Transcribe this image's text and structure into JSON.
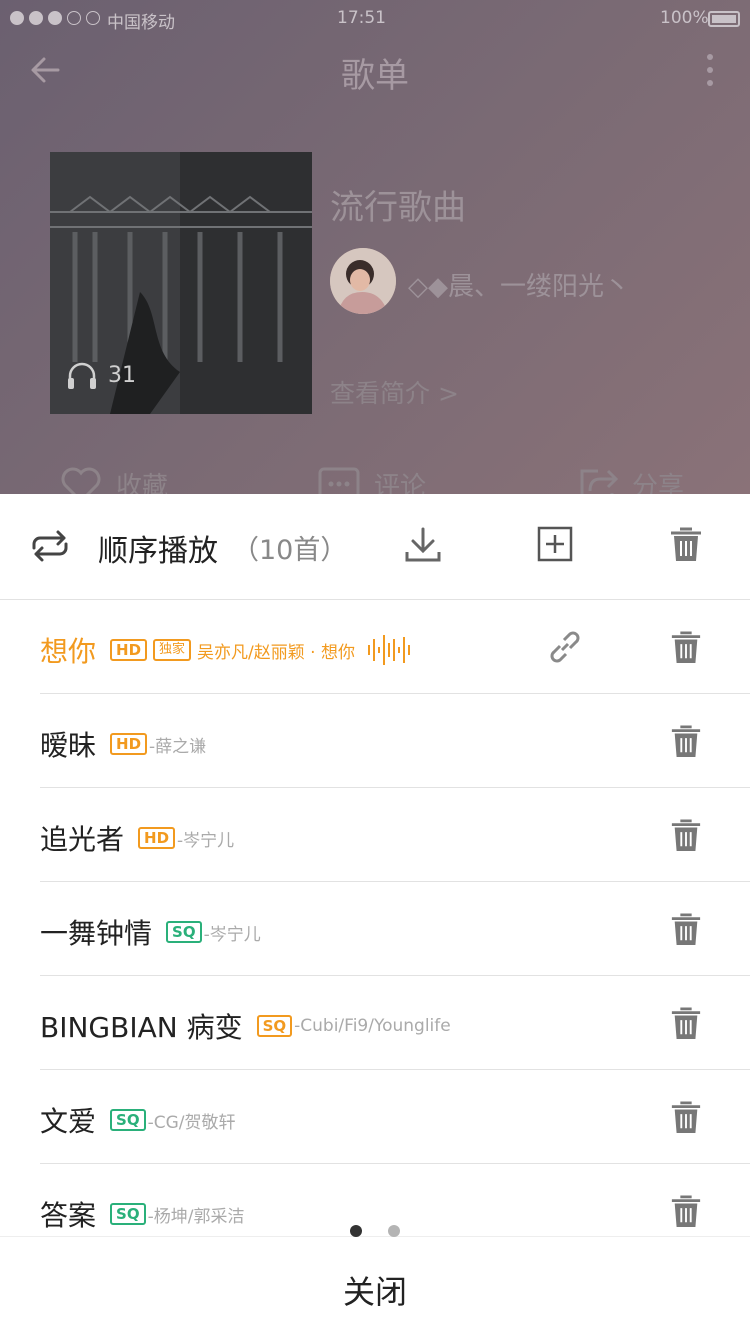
{
  "status_bar": {
    "carrier": "中国移动",
    "time": "17:51",
    "battery": "100%"
  },
  "nav": {
    "title": "歌单"
  },
  "playlist": {
    "cover_listens": "31",
    "title": "流行歌曲",
    "creator": "◇◆晨、一缕阳光丶",
    "view_intro": "查看简介 >"
  },
  "actions": {
    "favorite": "收藏",
    "comment": "评论",
    "share": "分享"
  },
  "sheet": {
    "play_mode": "顺序播放",
    "song_count": "（10首）",
    "close": "关闭"
  },
  "songs": [
    {
      "title": "想你",
      "badge": "HD",
      "exclusive": "独家",
      "artist": "吴亦凡/赵丽颖 · 想你"
    },
    {
      "title": "暧昧",
      "badge": "HD",
      "artist": "-薛之谦"
    },
    {
      "title": "追光者",
      "badge": "HD",
      "artist": "-岑宁儿"
    },
    {
      "title": "一舞钟情",
      "badge": "SQ",
      "artist": "-岑宁儿"
    },
    {
      "title": "BINGBIAN 病变",
      "badge": "SQ",
      "artist": "-Cubi/Fi9/Younglife"
    },
    {
      "title": "文爱",
      "badge": "SQ",
      "artist": "-CG/贺敬轩"
    },
    {
      "title": "答案",
      "badge": "SQ",
      "artist": "-杨坤/郭采洁"
    }
  ],
  "colors": {
    "accent": "#f29a1f",
    "sq": "#2ab07a"
  }
}
